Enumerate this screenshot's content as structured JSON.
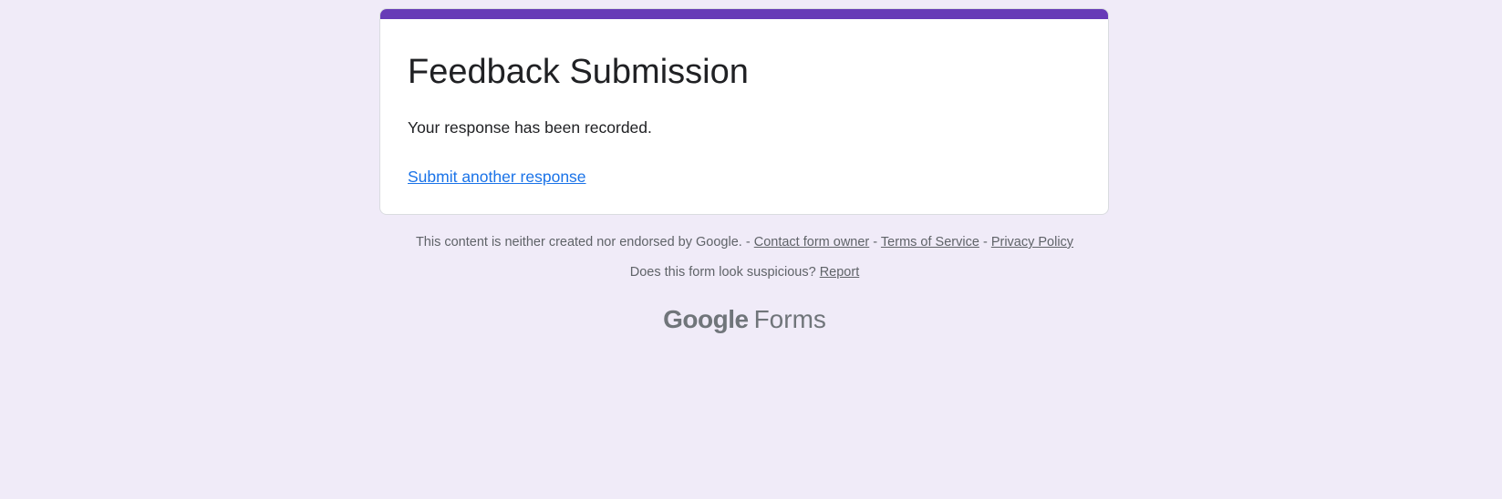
{
  "form": {
    "title": "Feedback Submission",
    "confirmation": "Your response has been recorded.",
    "submit_another": "Submit another response"
  },
  "footer": {
    "disclaimer": "This content is neither created nor endorsed by Google.",
    "separator": "-",
    "contact_owner": "Contact form owner",
    "terms": "Terms of Service",
    "privacy": "Privacy Policy",
    "suspicious_question": "Does this form look suspicious?",
    "report": "Report"
  },
  "brand": {
    "google": "Google",
    "product": "Forms"
  },
  "colors": {
    "page_background": "#f0ebf8",
    "accent": "#673ab7",
    "link": "#1a73e8",
    "footer_text": "#5f6368"
  }
}
